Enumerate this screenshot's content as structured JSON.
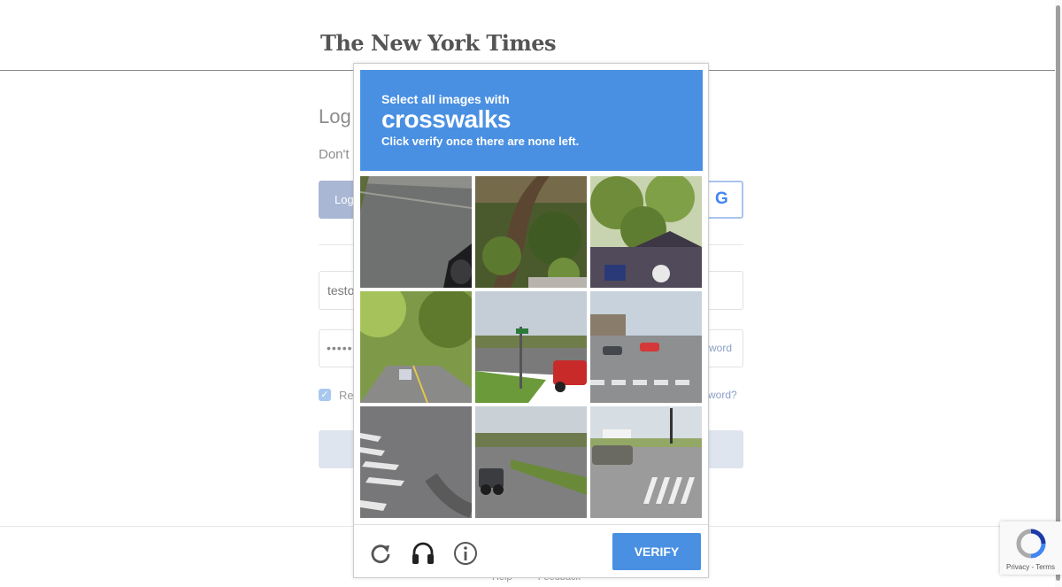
{
  "site": {
    "logo": "The New York Times",
    "login_title": "Log",
    "no_account_text": "Don't",
    "login_button_label": "Log",
    "google_button_label": "G",
    "email_value": "testo",
    "password_value": "•••••",
    "show_password_label": "word",
    "remember_label": "Re",
    "forgot_password_label": "ssword?",
    "footer_links": [
      "Help",
      "Feedback"
    ]
  },
  "captcha": {
    "instruction_line": "Select all images with",
    "target": "crosswalks",
    "sub_instruction": "Click verify once there are none left.",
    "tiles": [
      {
        "row": 1,
        "col": 1,
        "scene": "asphalt road with car edge"
      },
      {
        "row": 1,
        "col": 2,
        "scene": "tree branches"
      },
      {
        "row": 1,
        "col": 3,
        "scene": "trees over building"
      },
      {
        "row": 2,
        "col": 1,
        "scene": "curving road through trees"
      },
      {
        "row": 2,
        "col": 2,
        "scene": "street sign with red car"
      },
      {
        "row": 2,
        "col": 3,
        "scene": "intersection with crosswalk"
      },
      {
        "row": 3,
        "col": 1,
        "scene": "crosswalk stripes"
      },
      {
        "row": 3,
        "col": 2,
        "scene": "road with jeep"
      },
      {
        "row": 3,
        "col": 3,
        "scene": "intersection with crosswalk and billboard"
      }
    ],
    "reload_icon": "reload-icon",
    "audio_icon": "headphones-icon",
    "info_icon": "info-icon",
    "verify_label": "VERIFY"
  },
  "badge": {
    "terms_text": "Privacy - Terms"
  },
  "colors": {
    "captcha_blue": "#4a90e2",
    "login_button": "#a9b7d4"
  }
}
